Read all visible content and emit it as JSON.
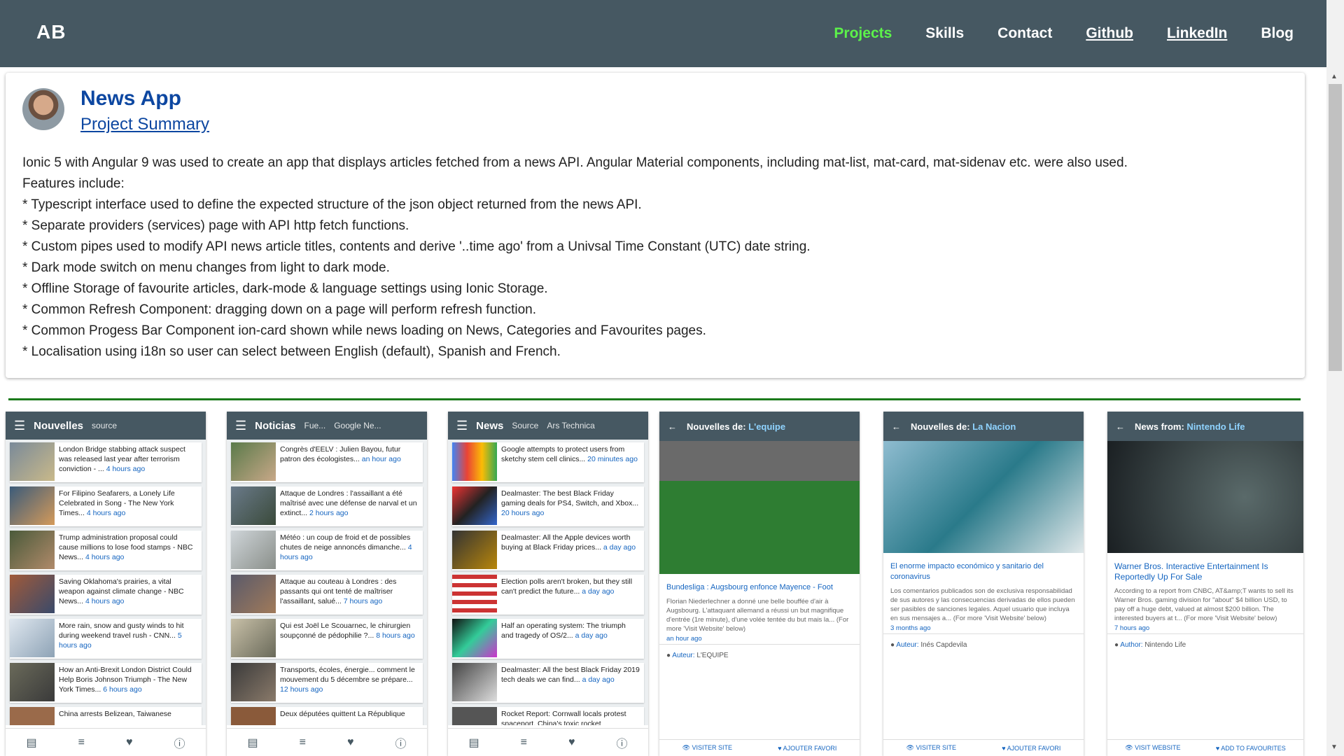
{
  "nav": {
    "brand": "AB",
    "links": [
      "Projects",
      "Skills",
      "Contact",
      "Github",
      "LinkedIn",
      "Blog"
    ]
  },
  "project": {
    "title": "News App",
    "subtitle": "Project Summary",
    "description": [
      " Ionic 5 with Angular 9 was used to create an app that displays articles fetched from a news API. Angular Material components, including mat-list, mat-card, mat-sidenav etc. were also used.",
      "Features include:",
      "* Typescript interface used to define the expected structure of the json object returned from the news API.",
      "* Separate providers (services) page with API http fetch functions.",
      "* Custom pipes used to modify API news article titles, contents and derive '..time ago' from a Univsal Time Constant (UTC) date string.",
      "* Dark mode switch on menu changes from light to dark mode.",
      "* Offline Storage of favourite articles, dark-mode & language settings using Ionic Storage.",
      "* Common Refresh Component: dragging down on a page will perform refresh function.",
      "* Common Progess Bar Component ion-card shown while news loading on News, Categories and Favourites pages.",
      "* Localisation using i18n so user can select between English (default), Spanish and French."
    ]
  },
  "phones": {
    "p1": {
      "title": "Nouvelles",
      "source": "source",
      "items": [
        {
          "text": "London Bridge stabbing attack suspect was released last year after terrorism conviction - ...",
          "ago": "4 hours ago"
        },
        {
          "text": "For Filipino Seafarers, a Lonely Life Celebrated in Song - The New York Times...",
          "ago": "4 hours ago"
        },
        {
          "text": "Trump administration proposal could cause millions to lose food stamps - NBC News...",
          "ago": "4 hours ago"
        },
        {
          "text": "Saving Oklahoma's prairies, a vital weapon against climate change - NBC News...",
          "ago": "4 hours ago"
        },
        {
          "text": "More rain, snow and gusty winds to hit during weekend travel rush - CNN...",
          "ago": "5 hours ago"
        },
        {
          "text": "How an Anti-Brexit London District Could Help Boris Johnson Triumph - The New York Times...",
          "ago": "6 hours ago"
        },
        {
          "text": "China arrests Belizean, Taiwanese",
          "ago": ""
        }
      ]
    },
    "p2": {
      "title": "Noticias",
      "source": "Fue...",
      "source2": "Google Ne...",
      "items": [
        {
          "text": "Congrès d'EELV : Julien Bayou, futur patron des écologistes...",
          "ago": "an hour ago"
        },
        {
          "text": "Attaque de Londres : l'assaillant a été maîtrisé avec une défense de narval et un extinct...",
          "ago": "2 hours ago"
        },
        {
          "text": "Météo : un coup de froid et de possibles chutes de neige annoncés dimanche...",
          "ago": "4 hours ago"
        },
        {
          "text": "Attaque au couteau à Londres : des passants qui ont tenté de maîtriser l'assaillant, salué...",
          "ago": "7 hours ago"
        },
        {
          "text": "Qui est Joël Le Scouarnec, le chirurgien soupçonné de pédophilie ?...",
          "ago": "8 hours ago"
        },
        {
          "text": "Transports, écoles, énergie... comment le mouvement du 5 décembre se prépare...",
          "ago": "12 hours ago"
        },
        {
          "text": "Deux députées quittent La République",
          "ago": ""
        }
      ]
    },
    "p3": {
      "title": "News",
      "source": "Source",
      "source2": "Ars Technica",
      "items": [
        {
          "text": "Google attempts to protect users from sketchy stem cell clinics...",
          "ago": "20 minutes ago"
        },
        {
          "text": "Dealmaster: The best Black Friday gaming deals for PS4, Switch, and Xbox...",
          "ago": "20 hours ago"
        },
        {
          "text": "Dealmaster: All the Apple devices worth buying at Black Friday prices...",
          "ago": "a day ago"
        },
        {
          "text": "Election polls aren't broken, but they still can't predict the future...",
          "ago": "a day ago"
        },
        {
          "text": "Half an operating system: The triumph and tragedy of OS/2...",
          "ago": "a day ago"
        },
        {
          "text": "Dealmaster: All the best Black Friday 2019 tech deals we can find...",
          "ago": "a day ago"
        },
        {
          "text": "Rocket Report: Cornwall locals protest spaceport, China's toxic rocket",
          "ago": ""
        }
      ]
    },
    "p4": {
      "prefix": "Nouvelles de:",
      "source": "L'equipe",
      "headline": "Bundesliga : Augsbourg enfonce Mayence - Foot",
      "body": "Florian Niederlechner a donné une belle bouffée d'air à Augsbourg. L'attaquant allemand a réussi un but magnifique d'entrée (1re minute), d'une volée tentée du but mais la... (For more 'Visit Website' below)",
      "ago": "an hour ago",
      "author_label": "Auteur:",
      "author": "L'EQUIPE",
      "visit": "VISITER SITE",
      "fav": "AJOUTER FAVORI"
    },
    "p5": {
      "prefix": "Nouvelles de:",
      "source": "La Nacion",
      "headline": "El enorme impacto económico y sanitario del coronavirus",
      "body": "Los comentarios publicados son de exclusiva responsabilidad de sus autores y las consecuencias derivadas de ellos pueden ser pasibles de sanciones legales. Aquel usuario que incluya en sus mensajes a... (For more 'Visit Website' below)",
      "ago": "3 months ago",
      "author_label": "Auteur:",
      "author": "Inés Capdevila",
      "visit": "VISITER SITE",
      "fav": "AJOUTER FAVORI"
    },
    "p6": {
      "prefix": "News from:",
      "source": "Nintendo Life",
      "headline": "Warner Bros. Interactive Entertainment Is Reportedly Up For Sale",
      "body": "According to a report from CNBC, AT&amp;T wants to sell its Warner Bros. gaming division for \"about\" $4 billion USD, to pay off a huge debt, valued at almost $200 billion. The interested buyers at t... (For more 'Visit Website' below)",
      "ago": "7 hours ago",
      "author_label": "Author:",
      "author": "Nintendo Life",
      "visit": "VISIT WEBSITE",
      "fav": "ADD TO FAVOURITES"
    }
  }
}
